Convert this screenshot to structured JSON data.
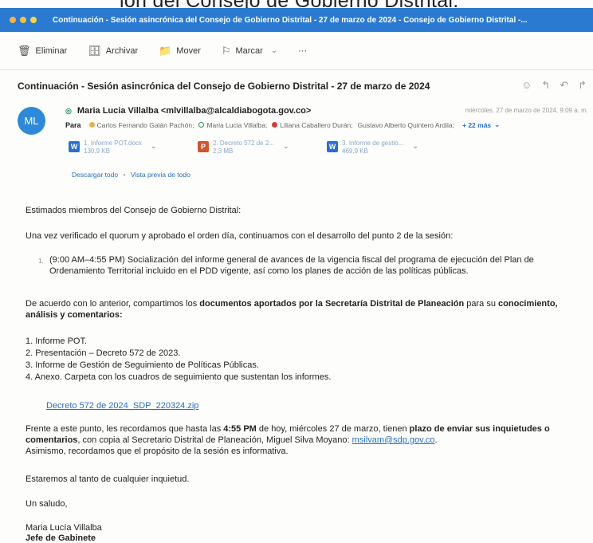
{
  "top_fragment": "ión del Consejo de Gobierno Distrital.",
  "window": {
    "title": "Continuación - Sesión asincrónica del Consejo de Gobierno Distrital - 27 de marzo de 2024 - Consejo de Gobierno Distrital -...",
    "dot_colors": [
      "#f3b54a",
      "#f6c244",
      "#f5d64a"
    ]
  },
  "toolbar": {
    "delete": "Eliminar",
    "archive": "Archivar",
    "move": "Mover",
    "flag": "Marcar",
    "more": "···"
  },
  "email": {
    "subject": "Continuación - Sesión asincrónica del Consejo de Gobierno Distrital - 27 de marzo de 2024",
    "avatar_initials": "ML",
    "sender": "Maria Lucia Villalba <mlvillalba@alcaldiabogota.gov.co>",
    "date": "miércoles, 27 de marzo de 2024, 9:09 a. m.",
    "to_label": "Para",
    "recipients": [
      {
        "name": "Carlos Fernando Galán Pachón;",
        "color": "#e8b04a"
      },
      {
        "name": "Maria Lucia Villalba;",
        "color": "#2d8f5a"
      },
      {
        "name": "Liliana Caballero Durán;",
        "color": "#d23b3b"
      },
      {
        "name": "Gustavo Alberto Quintero Ardila;",
        "color": ""
      }
    ],
    "more_recipients": "+ 22 más",
    "attachments": [
      {
        "name": "1. Informe POT.docx",
        "size": "130,9 KB",
        "type": "W",
        "color": "#2b6ed1"
      },
      {
        "name": "2. Decreto 572 de 2...",
        "size": "2,3 MB",
        "type": "P",
        "color": "#d2532c"
      },
      {
        "name": "3. Informe de gestio...",
        "size": "469,9 KB",
        "type": "W",
        "color": "#2b6ed1"
      }
    ],
    "download_all": "Descargar todo",
    "preview_all": "Vista previa de todo",
    "body": {
      "greeting": "Estimados miembros del Consejo de Gobierno Distrital:",
      "p1": "Una vez verificado el quorum y aprobado el orden día, continuamos con el desarrollo del punto 2 de la sesión:",
      "item1_num": "1.",
      "item1": "(9:00 AM–4:55 PM) Socialización del informe general de avances de la vigencia fiscal del programa de ejecución del Plan de Ordenamiento Territorial incluido en el PDD vigente, así como los planes de acción de las políticas públicas.",
      "p2_a": "De acuerdo con lo anterior, compartimos los ",
      "p2_b": "documentos aportados por la Secretaría Distrital de Planeación",
      "p2_c": " para su ",
      "p2_d": "conocimiento, análisis y comentarios:",
      "list": [
        "1. Informe POT.",
        "2. Presentación – Decreto 572 de 2023.",
        "3. Informe de Gestión de Seguimiento de Políticas Públicas.",
        "4. Anexo. Carpeta con los cuadros de seguimiento que sustentan los informes."
      ],
      "link": "Decreto 572 de 2024_SDP_220324.zip",
      "p3_a": "Frente a este punto, les recordamos que hasta las ",
      "p3_b": "4:55 PM",
      "p3_c": " de hoy, miércoles 27 de marzo, tienen ",
      "p3_d": "plazo de enviar sus inquietudes o comentarios",
      "p3_e": ", con copia al Secretario Distrital de Planeación, Miguel Silva Moyano: ",
      "p3_email": "msilvam@sdp.gov.co",
      "p3_f": ".",
      "p3_g": "Asimismo, recordamos que el propósito de la sesión es informativa.",
      "p4": "Estaremos al tanto de cualquier inquietud.",
      "p5": "Un saludo,",
      "sig_name": "Maria Lucía Villalba",
      "sig_title": "Jefe de Gabinete"
    }
  }
}
